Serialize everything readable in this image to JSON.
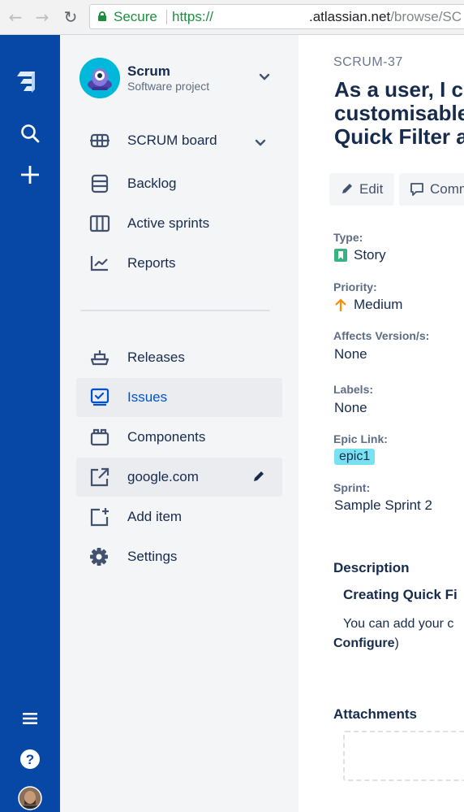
{
  "browser": {
    "secure_label": "Secure",
    "url_scheme": "https://",
    "url_host": ".atlassian.net",
    "url_path": "/browse/SC"
  },
  "global_nav": {
    "items": [
      "jira-logo-icon",
      "search-icon",
      "create-icon",
      "menu-icon",
      "help-icon",
      "user-avatar"
    ]
  },
  "project": {
    "name": "Scrum",
    "type": "Software project"
  },
  "sidebar": {
    "items": [
      {
        "label": "SCRUM board",
        "icon": "board-icon"
      },
      {
        "label": "Backlog",
        "icon": "backlog-icon"
      },
      {
        "label": "Active sprints",
        "icon": "sprints-icon"
      },
      {
        "label": "Reports",
        "icon": "reports-icon"
      },
      {
        "label": "Releases",
        "icon": "releases-icon"
      },
      {
        "label": "Issues",
        "icon": "issues-icon"
      },
      {
        "label": "Components",
        "icon": "components-icon"
      },
      {
        "label": "google.com",
        "icon": "external-link-icon"
      },
      {
        "label": "Add item",
        "icon": "add-item-icon"
      },
      {
        "label": "Settings",
        "icon": "settings-icon"
      }
    ],
    "selected": "Issues"
  },
  "issue": {
    "key": "SCRUM-37",
    "title_lines": [
      "As a user, I c",
      "customisable",
      "Quick Filter a"
    ],
    "actions": {
      "edit": "Edit",
      "comment": "Comm"
    },
    "fields": {
      "type_label": "Type:",
      "type_value": "Story",
      "priority_label": "Priority:",
      "priority_value": "Medium",
      "affects_label": "Affects Version/s:",
      "affects_value": "None",
      "labels_label": "Labels:",
      "labels_value": "None",
      "epic_label": "Epic Link:",
      "epic_value": "epic1",
      "sprint_label": "Sprint:",
      "sprint_value": "Sample Sprint 2"
    },
    "description": {
      "heading": "Description",
      "subheading": "Creating Quick Fi",
      "line1": "You can add your c",
      "line2": "Configure",
      "line2_suffix": ")"
    },
    "attachments_heading": "Attachments"
  },
  "colors": {
    "global_nav": "#0747a6",
    "sidebar_bg": "#f4f5f7",
    "selected_text": "#0052cc",
    "story_green": "#36b37e",
    "priority_orange": "#ff8b00",
    "epic_bg": "#79e2f2"
  }
}
